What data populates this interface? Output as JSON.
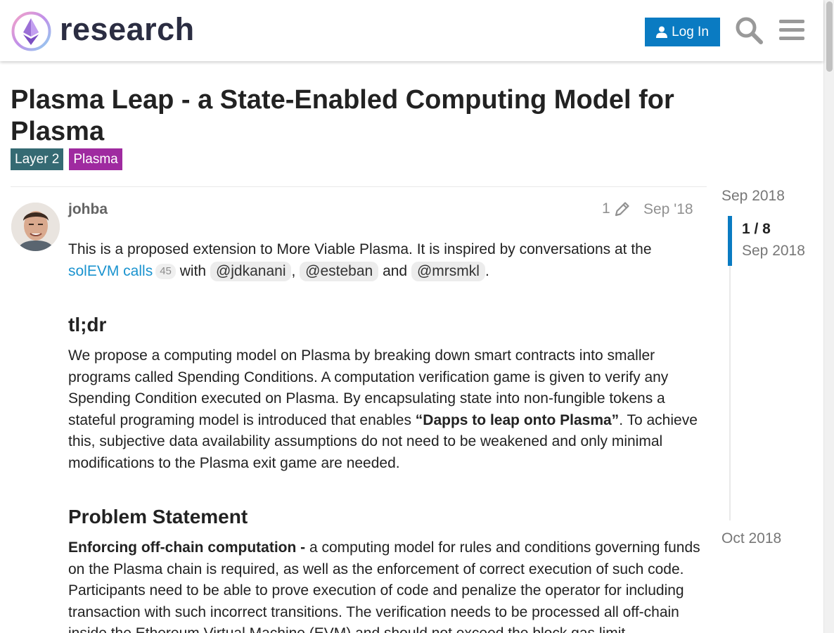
{
  "header": {
    "logo_text": "research",
    "login_label": "Log In",
    "search_icon": "search-icon",
    "menu_icon": "hamburger-menu-icon"
  },
  "topic": {
    "title": "Plasma Leap - a State-Enabled Computing Model for Plasma",
    "tags": [
      {
        "label": "Layer 2",
        "color": "#356a73"
      },
      {
        "label": "Plasma",
        "color": "#9f2aa0"
      }
    ]
  },
  "post": {
    "username": "johba",
    "edit_count": "1",
    "date": "Sep '18",
    "intro_text": "This is a proposed extension to More Viable Plasma. It is inspired by conversations at the",
    "link_label": "solEVM calls",
    "link_clicks": "45",
    "with_text": "with",
    "mentions": [
      "@jdkanani",
      "@esteban",
      "@mrsmkl"
    ],
    "comma": ",",
    "and_text": "and",
    "period": ".",
    "h_tldr": "tl;dr",
    "tldr_a": "We propose a computing model on Plasma by breaking down smart contracts into smaller programs called Spending Conditions. A computation verification game is given to verify any Spending Condition executed on Plasma. By encapsulating state into non-fungible tokens a stateful programing model is introduced that enables",
    "tldr_bold": "“Dapps to leap onto Plasma”",
    "tldr_b": ". To achieve this, subjective data availability assumptions do not need to be weakened and only minimal modifications to the Plasma exit game are needed.",
    "h_problem": "Problem Statement",
    "problem_bold": "Enforcing off-chain computation -",
    "problem_text": "a computing model for rules and conditions governing funds on the Plasma chain is required, as well as the enforcement of correct execution of such code. Participants need to be able to prove execution of code and penalize the operator for including transaction with such incorrect transitions. The verification needs to be processed all off-chain inside the Ethereum Virtual Machine (EVM) and should not exceed the block gas limit."
  },
  "timeline": {
    "start": "Sep 2018",
    "position": "1 / 8",
    "position_date": "Sep 2018",
    "end": "Oct 2018"
  },
  "colors": {
    "accent": "#0a7bc2",
    "link": "#1a93cf"
  }
}
